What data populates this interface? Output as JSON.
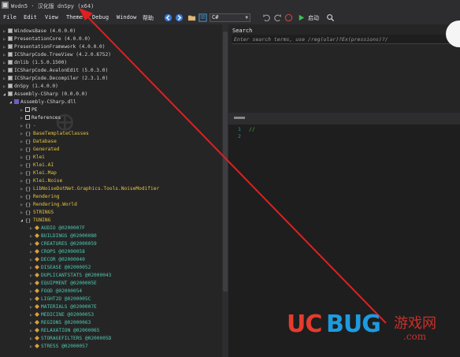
{
  "window": {
    "title": "Wvdn5 · 汉化版 dnSpy (x64)"
  },
  "menu": [
    "File",
    "Edit",
    "View",
    "Theme",
    "Debug",
    "Window",
    "帮助"
  ],
  "toolbar": {
    "language": "C#",
    "start_label": "启动"
  },
  "tree": [
    {
      "text": "WindowsBase (4.0.0.0)",
      "kind": "asm"
    },
    {
      "text": "PresentationCore (4.0.0.0)",
      "kind": "asm"
    },
    {
      "text": "PresentationFramework (4.0.0.0)",
      "kind": "asm"
    },
    {
      "text": "ICSharpCode.TreeView (4.2.0.8752)",
      "kind": "asm"
    },
    {
      "text": "dnlib (1.5.0.1500)",
      "kind": "asm"
    },
    {
      "text": "ICSharpCode.AvalonEdit (5.0.3.0)",
      "kind": "asm"
    },
    {
      "text": "ICSharpCode.Decompiler (2.3.1.0)",
      "kind": "asm"
    },
    {
      "text": "dnSpy (1.4.0.0)",
      "kind": "asm"
    },
    {
      "text": "Assembly-CSharp (0.0.0.0)",
      "kind": "asm-open"
    },
    {
      "text": "Assembly-CSharp.dll",
      "kind": "module"
    },
    {
      "text": "PE",
      "kind": "white"
    },
    {
      "text": "References",
      "kind": "white"
    },
    {
      "text": "-",
      "kind": "ns"
    },
    {
      "text": "BaseTemplateClasses",
      "kind": "ns"
    },
    {
      "text": "Database",
      "kind": "ns"
    },
    {
      "text": "Generated",
      "kind": "ns"
    },
    {
      "text": "Klei",
      "kind": "ns"
    },
    {
      "text": "Klei.AI",
      "kind": "ns"
    },
    {
      "text": "Klei.Map",
      "kind": "ns"
    },
    {
      "text": "Klei.Noise",
      "kind": "ns"
    },
    {
      "text": "LibNoiseDotNet.Graphics.Tools.NoiseModifier",
      "kind": "ns"
    },
    {
      "text": "Rendering",
      "kind": "ns"
    },
    {
      "text": "Rendering.World",
      "kind": "ns"
    },
    {
      "text": "STRINGS",
      "kind": "ns"
    },
    {
      "text": "TUNING",
      "kind": "ns-open"
    },
    {
      "text": "AUDIO @0200007F",
      "kind": "type"
    },
    {
      "text": "BUILDINGS @02000080",
      "kind": "type"
    },
    {
      "text": "CREATURES @02000059",
      "kind": "type"
    },
    {
      "text": "CROPS @02000058",
      "kind": "type"
    },
    {
      "text": "DECOR @02000040",
      "kind": "type"
    },
    {
      "text": "DISEASE @02000052",
      "kind": "type"
    },
    {
      "text": "DUPLICANTSTATS @02000043",
      "kind": "type"
    },
    {
      "text": "EQUIPMENT @0200005E",
      "kind": "type"
    },
    {
      "text": "FOOD @02000054",
      "kind": "type"
    },
    {
      "text": "LIGHT2D @0200005C",
      "kind": "type"
    },
    {
      "text": "MATERIALS @0200007E",
      "kind": "type"
    },
    {
      "text": "MEDICINE @02000053",
      "kind": "type"
    },
    {
      "text": "REGIONS @02000063",
      "kind": "type"
    },
    {
      "text": "RELAXATION @02000065",
      "kind": "type"
    },
    {
      "text": "STORAGEFILTERS @0200005D",
      "kind": "type"
    },
    {
      "text": "STRESS @02000057",
      "kind": "type"
    }
  ],
  "search": {
    "title": "Search",
    "placeholder": "Enter search terms, use /reg(ular)?Ex(pressions)?/"
  },
  "editor": {
    "lines": [
      {
        "num": "1",
        "text": "//"
      },
      {
        "num": "2",
        "text": ""
      }
    ]
  },
  "watermark": {
    "brand_left": "UC",
    "brand_right": "BUG",
    "brand_cn": "游戏网",
    "brand_domain": ".com"
  },
  "colors": {
    "accent_red": "#e63b2e",
    "accent_blue": "#1d9be0"
  }
}
